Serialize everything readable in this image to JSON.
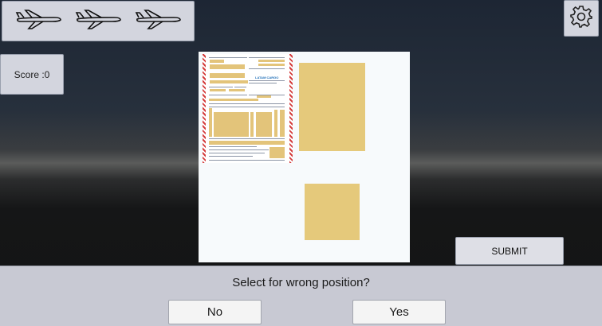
{
  "lives": {
    "icons": [
      "airplane-icon",
      "airplane-icon",
      "airplane-icon"
    ]
  },
  "score": {
    "label": "Score :0"
  },
  "settings": {
    "icon": "gear-icon"
  },
  "document": {
    "logo_text": "LATAM CARGO",
    "colors": {
      "paper": "#f7fafc",
      "slot": "#e5c97b",
      "hatch": "#d43d3d"
    }
  },
  "submit": {
    "label": "SUBMIT"
  },
  "prompt": {
    "question": "Select for wrong position?",
    "no_label": "No",
    "yes_label": "Yes"
  }
}
